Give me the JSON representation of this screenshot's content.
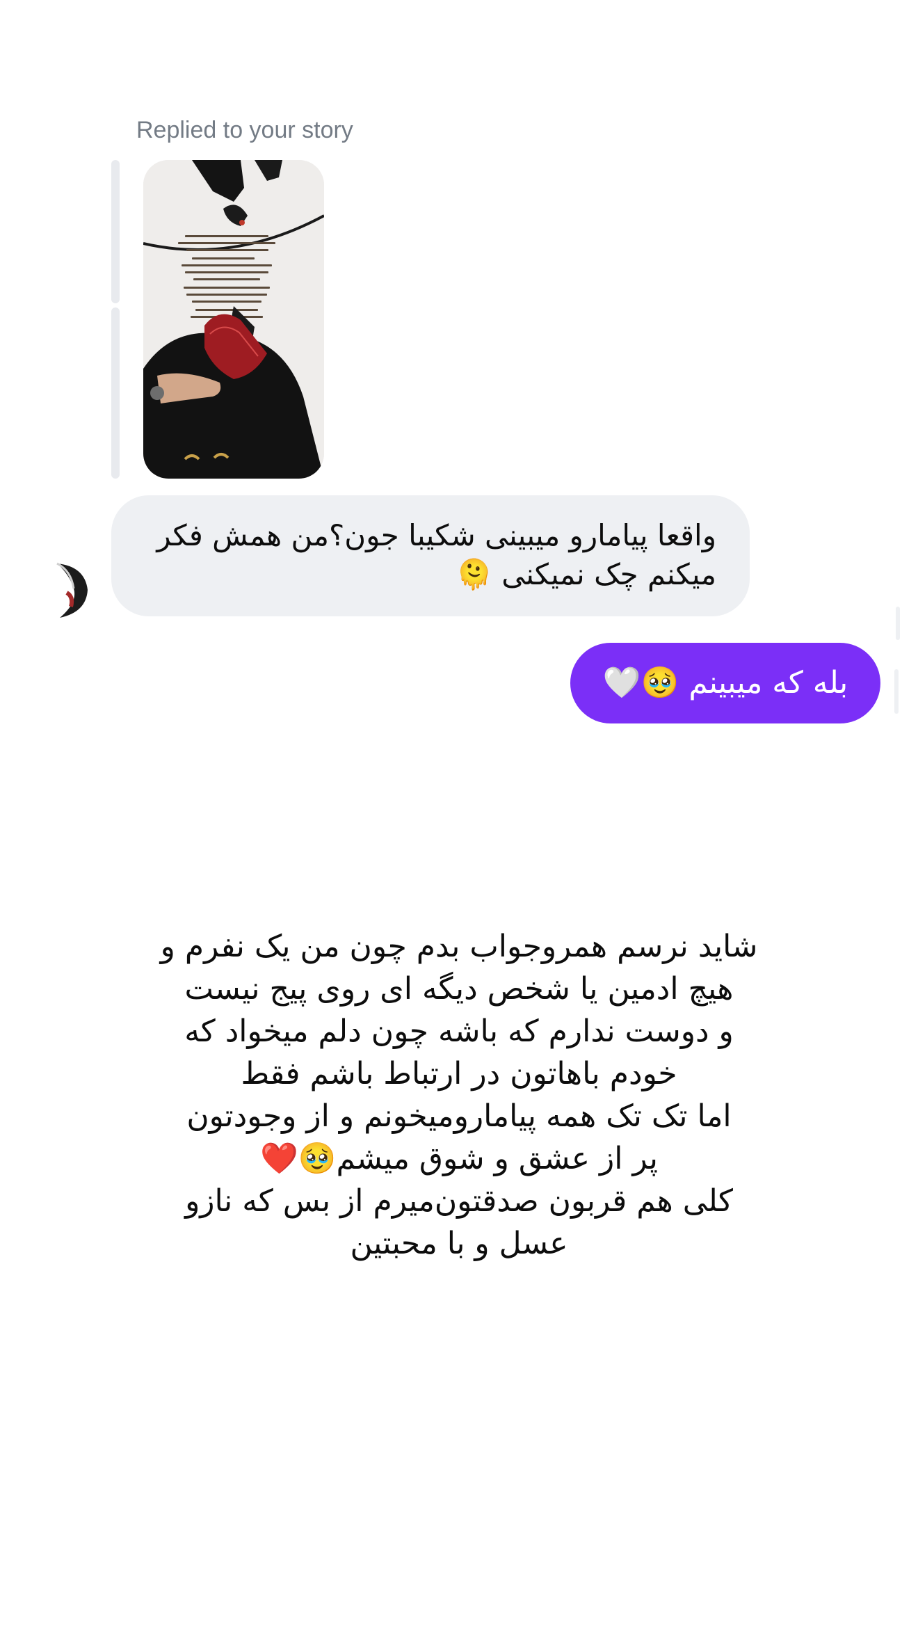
{
  "story_reply": {
    "label": "Replied to your story"
  },
  "messages": {
    "incoming": "واقعا پیامارو میبینی شکیبا جون؟من همش فکر میکنم چک نمیکنی 🫠",
    "outgoing": "بله که میبینم 🥹🤍"
  },
  "note": {
    "lines": [
      "شاید نرسم همروجواب بدم چون من یک نفرم و",
      "هیچ ادمین یا شخص دیگه ای روی پیج نیست",
      "و دوست ندارم که باشه چون دلم میخواد که",
      "خودم باهاتون در ارتباط باشم فقط",
      "اما تک تک همه پیامارو‌میخونم و از وجودتون",
      "پر از عشق و شوق میشم🥹❤️",
      "کلی هم قربون صدقتون‌میرم از بس که نازو",
      "عسل و با محبتین"
    ]
  },
  "colors": {
    "incoming_bubble": "#eef0f3",
    "outgoing_bubble": "#7b2ff7",
    "reply_label": "#737b85",
    "text": "#0d0d0d"
  }
}
